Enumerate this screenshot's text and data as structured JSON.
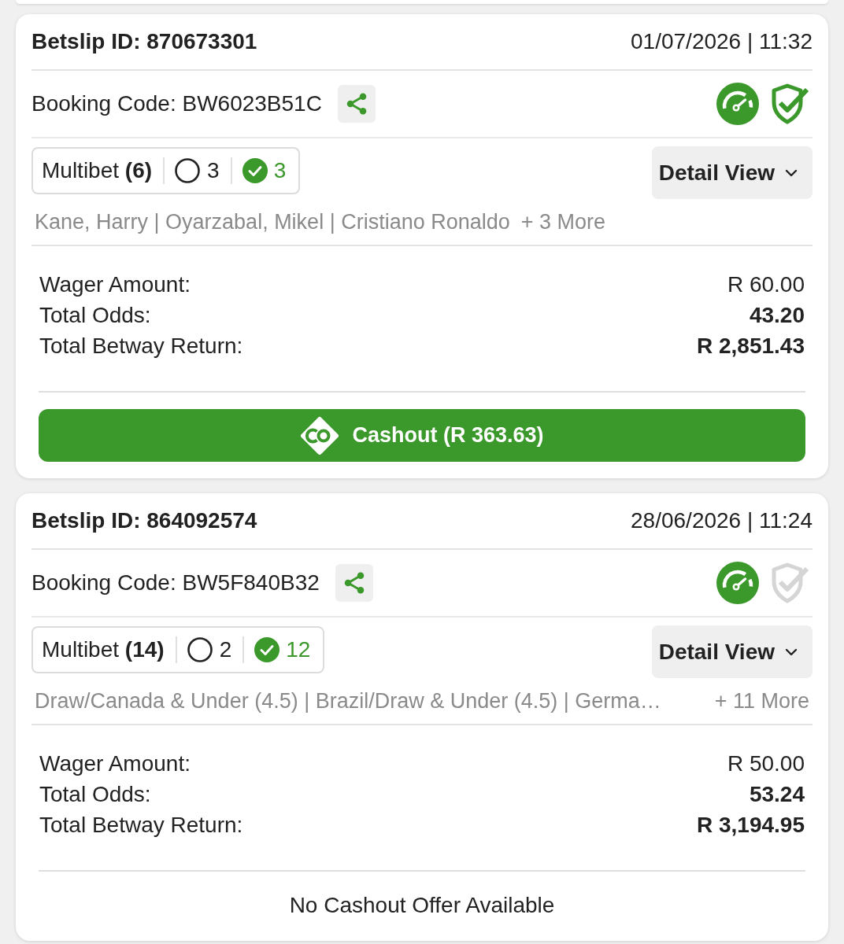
{
  "betslips": [
    {
      "title": "Betslip ID: 870673301",
      "datetime": "01/07/2026 | 11:32",
      "booking_code": "Booking Code: BW6023B51C",
      "shield_active": true,
      "bet_type": "Multibet **(6)**",
      "open_count": "3",
      "won_count": "3",
      "detail_button": "Detail View",
      "selections": "Kane, Harry | Oyarzabal, Mikel | Cristiano Ronaldo",
      "more": "+ 3 More",
      "summary": [
        {
          "label": "Wager Amount:",
          "value": "R 60.00",
          "emphasis": false
        },
        {
          "label": "Total Odds:",
          "value": "43.20",
          "emphasis": true
        },
        {
          "label": "Total Betway Return:",
          "value": "R 2,851.43",
          "emphasis": true
        }
      ],
      "cashout": {
        "kind": "button",
        "label": "Cashout (R 363.63)"
      }
    },
    {
      "title": "Betslip ID: 864092574",
      "datetime": "28/06/2026 | 11:24",
      "booking_code": "Booking Code: BW5F840B32",
      "shield_active": false,
      "bet_type": "Multibet **(14)**",
      "open_count": "2",
      "won_count": "12",
      "detail_button": "Detail View",
      "selections": "Draw/Canada & Under (4.5) | Brazil/Draw & Under (4.5) | Germa…",
      "more": "+ 11 More",
      "summary": [
        {
          "label": "Wager Amount:",
          "value": "R 50.00",
          "emphasis": false
        },
        {
          "label": "Total Odds:",
          "value": "53.24",
          "emphasis": true
        },
        {
          "label": "Total Betway Return:",
          "value": "R 3,194.95",
          "emphasis": true
        }
      ],
      "cashout": {
        "kind": "notice",
        "label": "No Cashout Offer Available"
      }
    }
  ]
}
